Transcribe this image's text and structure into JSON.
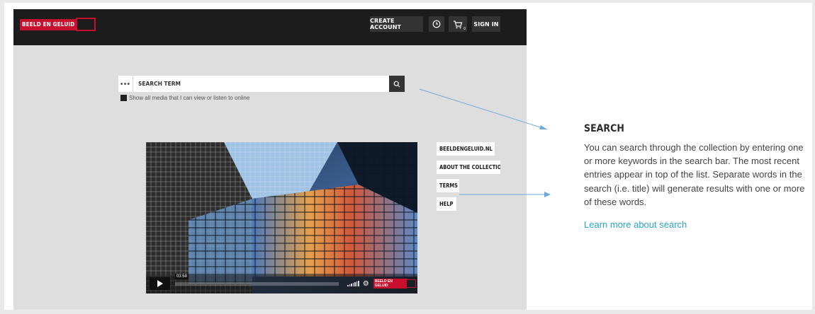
{
  "header": {
    "logo_text": "BEELD EN GELUID",
    "create_account_label": "CREATE ACCOUNT",
    "history_icon": "clock-icon",
    "cart_icon": "cart-icon",
    "cart_count": "0",
    "sign_in_label": "SIGN IN"
  },
  "search": {
    "more_label": "•••",
    "placeholder": "SEARCH TERM",
    "search_icon": "search-icon",
    "checkbox_label": "Show all media that I can view or listen to online"
  },
  "video": {
    "time": "03:58",
    "logo_text": "BEELD EN GELUID"
  },
  "side_links": [
    "BEELDENGELUID.NL",
    "ABOUT THE COLLECTIO",
    "TERMS",
    "HELP"
  ],
  "help_panel": {
    "title": "SEARCH",
    "body": "You can search through the collection by entering one or more keywords in the search bar. The most recent entries appear in top of the list. Separate words in the search (i.e. title) will generate results with one or more of these words.",
    "link": "Learn more about search"
  },
  "colors": {
    "topbar": "#1c1c1c",
    "brand_red": "#c8102e",
    "link_blue": "#2aa3cc",
    "arrow": "#6fa8dc"
  }
}
